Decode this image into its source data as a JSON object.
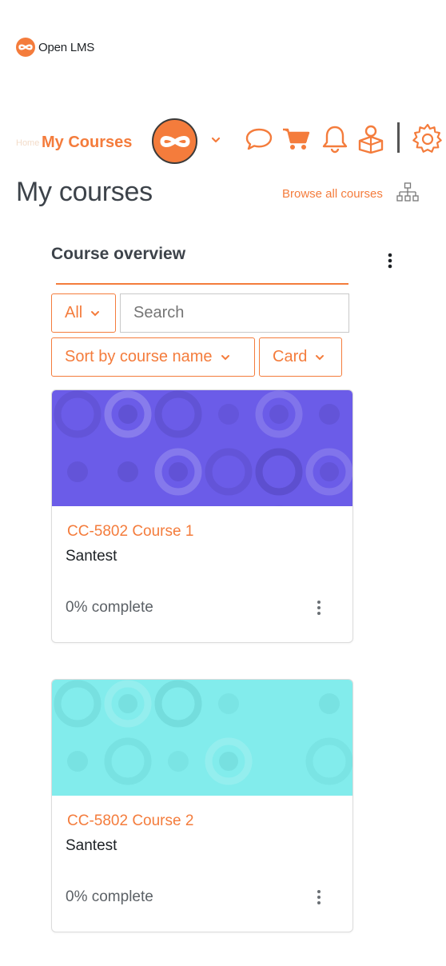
{
  "brand": {
    "name": "Open LMS",
    "accent": "#f47c3c"
  },
  "navbar": {
    "home_label": "Home",
    "my_courses_label": "My Courses",
    "icons": [
      "user-avatar-icon",
      "chevron-down-icon",
      "chat-bubble-icon",
      "shopping-cart-icon",
      "bell-icon",
      "personal-menu-icon",
      "gear-icon"
    ]
  },
  "page": {
    "title": "My courses",
    "browse_all_label": "Browse all courses"
  },
  "overview": {
    "title": "Course overview",
    "filter_label": "All",
    "search_placeholder": "Search",
    "sort_label": "Sort by course name",
    "view_label": "Card"
  },
  "courses": [
    {
      "name": "CC-5802 Course 1",
      "category": "Santest",
      "progress": "0% complete",
      "image_color": "#6b5ce8"
    },
    {
      "name": "CC-5802 Course 2",
      "category": "Santest",
      "progress": "0% complete",
      "image_color": "#82ecec"
    }
  ]
}
